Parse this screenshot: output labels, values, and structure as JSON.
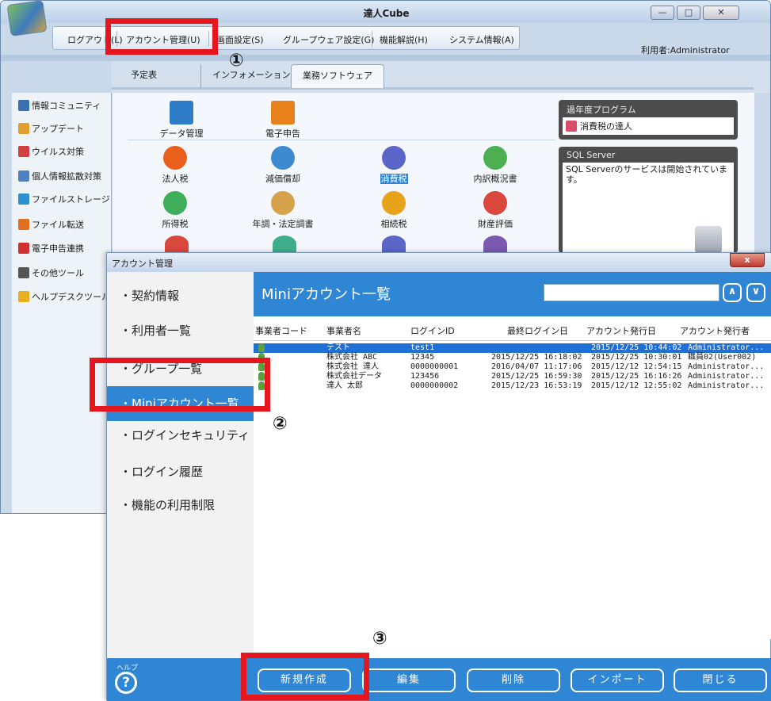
{
  "main_window": {
    "title": "達人Cube",
    "minimize": "—",
    "maximize": "□",
    "close": "✕",
    "menu": [
      "ログアウト(L)",
      "アカウント管理(U)",
      "画面設定(S)",
      "グループウェア設定(G)",
      "機能解説(H)",
      "システム情報(A)"
    ],
    "user_label": "利用者:Administrator",
    "tabs": [
      "予定表",
      "インフォメーション",
      "業務ソフトウェア"
    ],
    "sidebar": [
      "情報コミュニティ",
      "アップデート",
      "ウイルス対策",
      "個人情報拡散対策",
      "ファイルストレージ",
      "ファイル転送",
      "電子申告連携",
      "その他ツール",
      "ヘルプデスクツール"
    ],
    "sidebar_icon_colors": [
      "#3a6fb0",
      "#e0a030",
      "#d04040",
      "#5080c0",
      "#2c8fd0",
      "#e07020",
      "#d03030",
      "#555555",
      "#e8b020"
    ],
    "apps_row1": [
      "データ管理",
      "電子申告"
    ],
    "apps_row2": [
      "法人税",
      "減価償却",
      "消費税",
      "内訳概況書"
    ],
    "apps_row3": [
      "所得税",
      "年調・法定調書",
      "相続税",
      "財産評価"
    ],
    "app_colors_row2": [
      "#e8601c",
      "#3d8ad1",
      "#5a66c8",
      "#4caf50"
    ],
    "app_colors_row3": [
      "#3fae5a",
      "#d6a24a",
      "#e8a21c",
      "#d9473d"
    ],
    "past_programs": {
      "title": "過年度プログラム",
      "item": "消費税の達人"
    },
    "sql_server": {
      "title": "SQL Server",
      "message": "SQL Serverのサービスは開始されています。"
    }
  },
  "dialog": {
    "title": "アカウント管理",
    "close": "x",
    "nav": [
      "・契約情報",
      "・利用者一覧",
      "・グループ一覧",
      "・Miniアカウント一覧",
      "・ログインセキュリティ",
      "・ログイン履歴",
      "・機能の利用制限"
    ],
    "active_nav": "・Miniアカウント一覧",
    "help_label": "ヘルプ",
    "help_icon": "?",
    "heading": "Miniアカウント一覧",
    "search_value": "",
    "up_icon": "∧",
    "down_icon": "∨",
    "columns": [
      "事業者コード",
      "事業者名",
      "ログインID",
      "最終ログイン日",
      "アカウント発行日",
      "アカウント発行者"
    ],
    "rows": [
      {
        "code": "",
        "name": "テスト",
        "login_id": "test1",
        "last_login": "",
        "issued": "2015/12/25 10:44:02",
        "issuer": "Administrator..."
      },
      {
        "code": "",
        "name": "株式会社 ABC",
        "login_id": "12345",
        "last_login": "2015/12/25 16:18:02",
        "issued": "2015/12/25 10:30:01",
        "issuer": "職員02(User002)"
      },
      {
        "code": "",
        "name": "株式会社 達人",
        "login_id": "0000000001",
        "last_login": "2016/04/07 11:17:06",
        "issued": "2015/12/12 12:54:15",
        "issuer": "Administrator..."
      },
      {
        "code": "",
        "name": "株式会社データ",
        "login_id": "123456",
        "last_login": "2015/12/25 16:59:30",
        "issued": "2015/12/25 16:16:26",
        "issuer": "Administrator..."
      },
      {
        "code": "",
        "name": "達人 太郎",
        "login_id": "0000000002",
        "last_login": "2015/12/23 16:53:19",
        "issued": "2015/12/12 12:55:02",
        "issuer": "Administrator..."
      }
    ],
    "footer_buttons": [
      "新規作成",
      "編集",
      "削除",
      "インポート",
      "閉じる"
    ]
  },
  "annotations": {
    "step1": "①",
    "step2": "②",
    "step3": "③",
    "highlight_color": "#e5161d"
  }
}
